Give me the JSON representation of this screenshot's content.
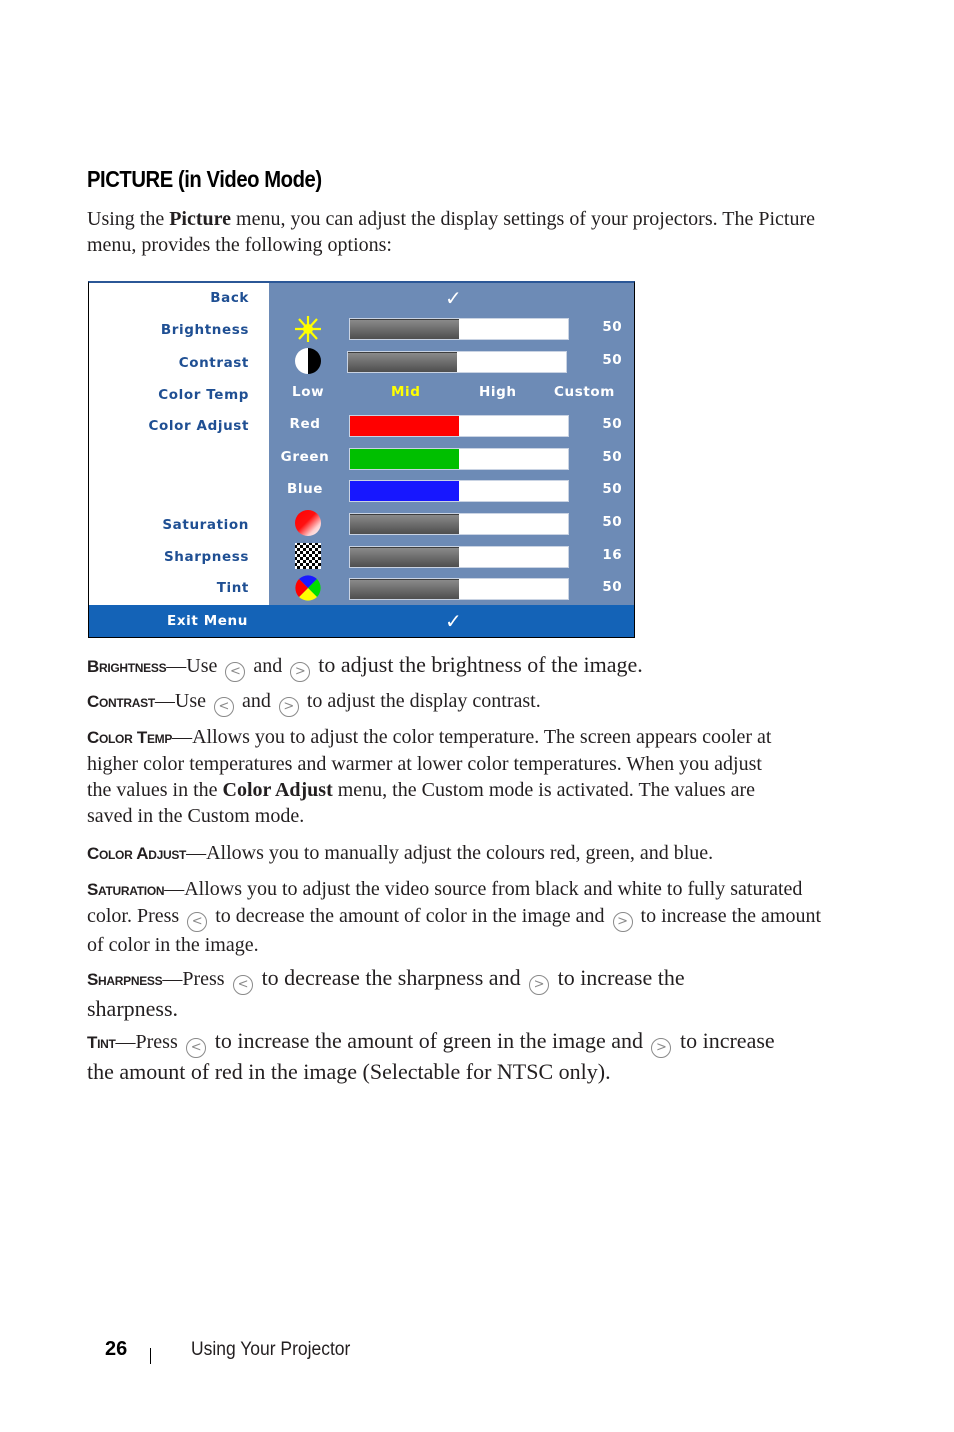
{
  "heading": "PICTURE (in Video Mode)",
  "intro": {
    "pre": "Using the ",
    "bold": "Picture",
    "post": " menu, you can adjust the display settings of your projectors. The Picture menu, provides the following options:"
  },
  "osd_menu": {
    "labels": {
      "back": "Back",
      "brightness": "Brightness",
      "contrast": "Contrast",
      "color_temp": "Color Temp",
      "color_adjust": "Color Adjust",
      "saturation": "Saturation",
      "sharpness": "Sharpness",
      "tint": "Tint",
      "exit": "Exit Menu"
    },
    "check_glyph": "✓",
    "brightness": {
      "value": "50",
      "fill_fraction": 0.5,
      "icon": "sun-icon"
    },
    "contrast": {
      "value": "50",
      "fill_fraction": 0.5,
      "icon": "contrast-icon"
    },
    "color_temp": {
      "options": [
        "Low",
        "Mid",
        "High",
        "Custom"
      ],
      "selected": "Mid"
    },
    "color_adjust": {
      "red": {
        "label": "Red",
        "value": "50",
        "fill_fraction": 0.5,
        "color": "#ff0000"
      },
      "green": {
        "label": "Green",
        "value": "50",
        "fill_fraction": 0.5,
        "color": "#00bf00"
      },
      "blue": {
        "label": "Blue",
        "value": "50",
        "fill_fraction": 0.5,
        "color": "#1717ff"
      }
    },
    "saturation": {
      "value": "50",
      "fill_fraction": 0.5,
      "icon": "saturation-icon"
    },
    "sharpness": {
      "value": "16",
      "fill_fraction": 0.5,
      "icon": "checkerboard-icon"
    },
    "tint": {
      "value": "50",
      "fill_fraction": 0.5,
      "icon": "tint-icon"
    },
    "colors": {
      "panel_bg": "#6d8bb6",
      "exit_bg": "#1463b7",
      "label_text": "#1f4f93",
      "selected_option": "#ffff00"
    }
  },
  "descriptions": {
    "brightness": {
      "term": "Brightness",
      "dash": "—",
      "t1": "Use",
      "t2": "and",
      "t3": "to adjust the brightness of the image."
    },
    "contrast": {
      "term": "Contrast",
      "dash": "—",
      "t1": "Use",
      "t2": "and",
      "t3": "to adjust the display contrast."
    },
    "color_temp": {
      "term": "Color Temp",
      "dash": "—",
      "t1": "Allows you to adjust the color temperature. The screen appears cooler at higher color temperatures and warmer at lower color temperatures. When you adjust the values in the ",
      "bold": "Color Adjust",
      "t2": " menu, the Custom mode is activated. The values are saved in the Custom mode."
    },
    "color_adjust": {
      "term": "Color Adjust",
      "dash": "—",
      "t1": "Allows you to manually adjust the colours red, green, and blue."
    },
    "saturation": {
      "term": "Saturation",
      "dash": "—",
      "t1": "Allows you to adjust the video source from black and white to fully saturated color. Press",
      "t2": "to decrease the amount of color in the image and",
      "t3": "to increase the amount of color in the image."
    },
    "sharpness": {
      "term": "Sharpness",
      "dash": "—",
      "t1": "Press",
      "t2": "to decrease the sharpness and",
      "t3": "to increase the sharpness."
    },
    "tint": {
      "term": "Tint",
      "dash": "—",
      "t1": "Press",
      "t2": "to increase the amount of green in the image and",
      "t3": "to increase the amount of red in the image (Selectable for NTSC only)."
    },
    "left_button_glyph": "<",
    "right_button_glyph": ">"
  },
  "footer": {
    "page_number": "26",
    "section": "Using Your Projector"
  }
}
